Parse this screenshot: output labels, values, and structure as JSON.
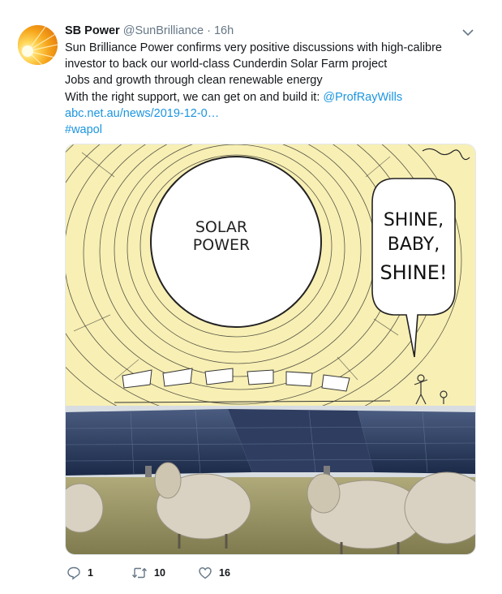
{
  "tweet": {
    "author_name": "SB Power",
    "handle": "@SunBrilliance",
    "separator": "·",
    "time": "16h",
    "lines": [
      "Sun Brilliance Power confirms very positive discussions with high-calibre",
      "investor to back our world-class Cunderdin Solar Farm project",
      "Jobs and growth through clean renewable energy"
    ],
    "support_text": "With the right support, we can get on and build it: ",
    "mention": "@ProfRayWills",
    "url": "abc.net.au/news/2019-12-0…",
    "hashtag": "#wapol"
  },
  "cartoon": {
    "sun_text_1": "SOLAR",
    "sun_text_2": "POWER",
    "bubble_1": "SHINE,",
    "bubble_2": "BABY,",
    "bubble_3": "SHINE!"
  },
  "actions": {
    "replies": "1",
    "retweets": "10",
    "likes": "16"
  },
  "colors": {
    "link": "#1b95e0",
    "secondary": "#657786",
    "sky": "#f8efb4",
    "avatar": "#f7a21d"
  },
  "icons": [
    "avatar-sun-icon",
    "chevron-down-icon",
    "reply-icon",
    "retweet-icon",
    "like-icon"
  ]
}
